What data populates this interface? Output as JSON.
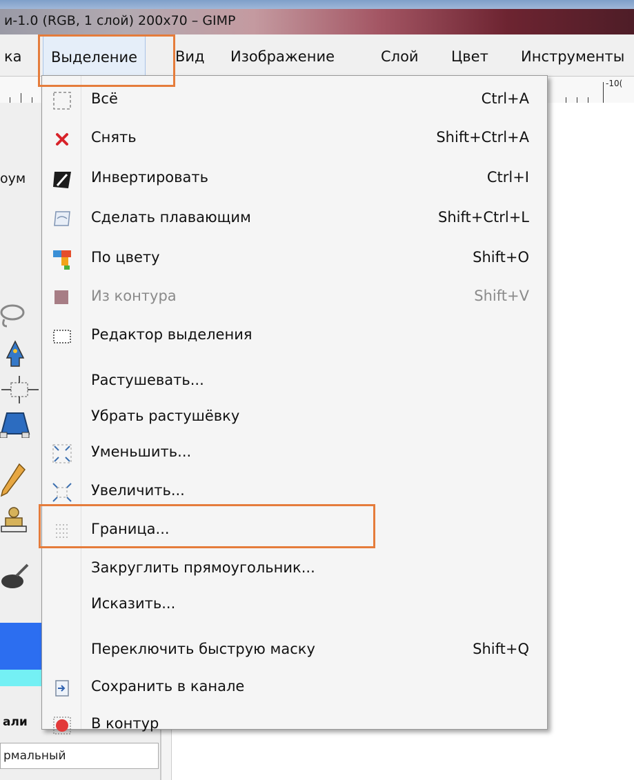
{
  "window": {
    "title": "и-1.0 (RGB, 1 слой) 200x70 – GIMP"
  },
  "menubar": {
    "items": [
      "ка",
      "Выделение",
      "Вид",
      "Изображение",
      "Слой",
      "Цвет",
      "Инструменты"
    ]
  },
  "ruler": {
    "label": "-10("
  },
  "toolbox": {
    "tab_label": "оум",
    "options_label": "али",
    "mode_value": "рмальный"
  },
  "menu": {
    "items": [
      {
        "label": "Всё",
        "shortcut": "Ctrl+A",
        "icon": "select-all-icon",
        "disabled": false
      },
      {
        "label": "Снять",
        "shortcut": "Shift+Ctrl+A",
        "icon": "select-none-icon",
        "disabled": false
      },
      {
        "label": "Инвертировать",
        "shortcut": "Ctrl+I",
        "icon": "invert-icon",
        "disabled": false
      },
      {
        "label": "Сделать плавающим",
        "shortcut": "Shift+Ctrl+L",
        "icon": "float-icon",
        "disabled": false
      },
      {
        "label": "По цвету",
        "shortcut": "Shift+O",
        "icon": "by-color-icon",
        "disabled": false
      },
      {
        "label": "Из контура",
        "shortcut": "Shift+V",
        "icon": "from-path-icon",
        "disabled": true
      },
      {
        "label": "Редактор выделения",
        "shortcut": "",
        "icon": "selection-editor-icon",
        "disabled": false
      },
      {
        "label": "Растушевать...",
        "shortcut": "",
        "icon": "",
        "disabled": false
      },
      {
        "label": "Убрать растушёвку",
        "shortcut": "",
        "icon": "",
        "disabled": false
      },
      {
        "label": "Уменьшить...",
        "shortcut": "",
        "icon": "shrink-icon",
        "disabled": false
      },
      {
        "label": "Увеличить...",
        "shortcut": "",
        "icon": "grow-icon",
        "disabled": false
      },
      {
        "label": "Граница...",
        "shortcut": "",
        "icon": "border-icon",
        "disabled": false
      },
      {
        "label": "Закруглить прямоугольник...",
        "shortcut": "",
        "icon": "",
        "disabled": false
      },
      {
        "label": "Исказить...",
        "shortcut": "",
        "icon": "",
        "disabled": false
      },
      {
        "label": "Переключить быструю маску",
        "shortcut": "Shift+Q",
        "icon": "",
        "disabled": false
      },
      {
        "label": "Сохранить в канале",
        "shortcut": "",
        "icon": "save-to-channel-icon",
        "disabled": false
      },
      {
        "label": "В контур",
        "shortcut": "",
        "icon": "to-path-icon",
        "disabled": false
      }
    ]
  },
  "highlight_color": "#e57c3b"
}
